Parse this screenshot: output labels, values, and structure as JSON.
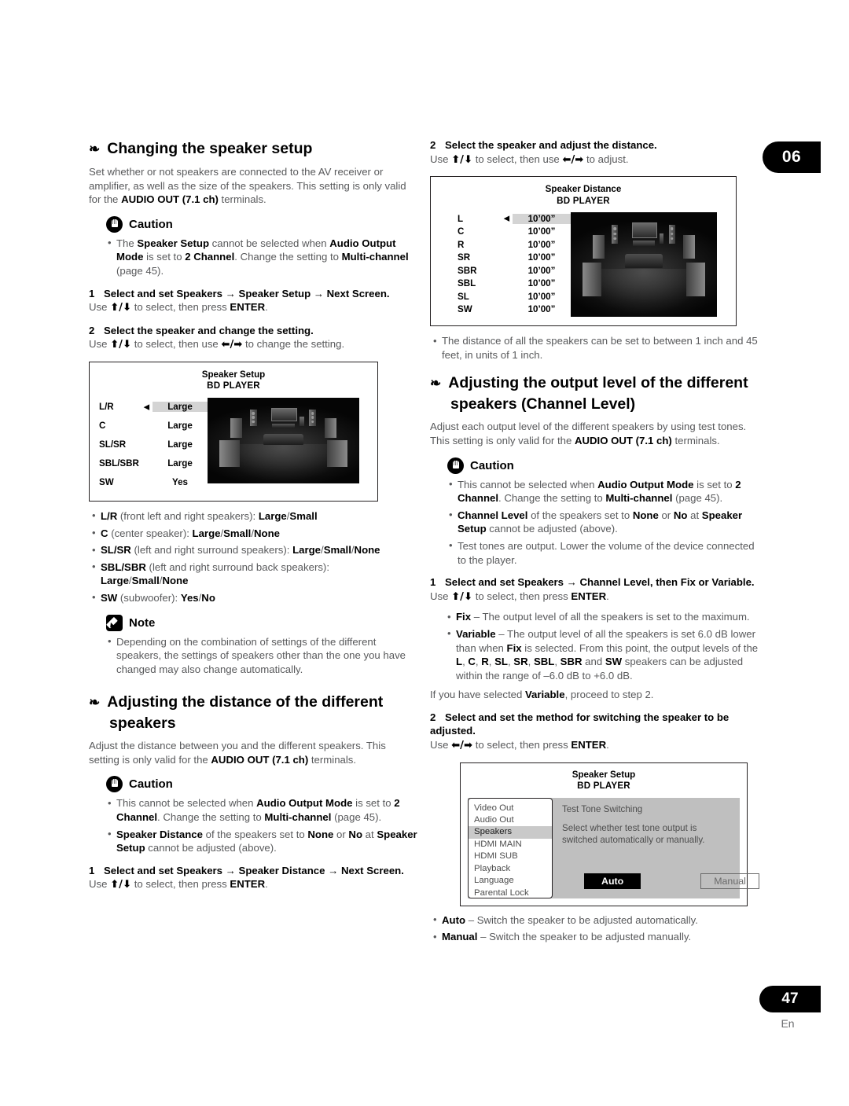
{
  "page": {
    "chapter_tab": "06",
    "page_number": "47",
    "language_mark": "En"
  },
  "left_column": {
    "section1": {
      "heading": "Changing the speaker setup",
      "intro_html": "Set whether or not speakers are connected to the AV receiver or amplifier, as well as the size of the speakers. This setting is only valid for the <b>AUDIO OUT (7.1 ch)</b> terminals.",
      "caution_label": "Caution",
      "caution_bullets_html": [
        "The <b>Speaker Setup</b> cannot be selected when <b>Audio Output Mode</b> is set to <b>2 Channel</b>. Change the setting to <b>Multi-channel</b> (page 45)."
      ],
      "step1_num": "1",
      "step1_text": "Select and set Speakers → Speaker Setup → Next Screen.",
      "step1_sub_html": "Use <b class=\"arrow-glyph\">⬆/⬇</b> to select, then press <b>ENTER</b>.",
      "step2_num": "2",
      "step2_text": "Select the speaker and change the setting.",
      "step2_sub_html": "Use <b class=\"arrow-glyph\">⬆/⬇</b> to select, then use <b class=\"arrow-glyph\">⬅/➡</b> to change the setting.",
      "screenshot": {
        "title": "Speaker Setup",
        "subtitle": "BD PLAYER",
        "rows": [
          {
            "label": "L/R",
            "value": "Large",
            "selected": true
          },
          {
            "label": "C",
            "value": "Large",
            "selected": false
          },
          {
            "label": "SL/SR",
            "value": "Large",
            "selected": false
          },
          {
            "label": "SBL/SBR",
            "value": "Large",
            "selected": false
          },
          {
            "label": "SW",
            "value": "Yes",
            "selected": false
          }
        ]
      },
      "option_bullets_html": [
        "<b>L/R</b> (front left and right speakers): <b>Large</b>/<b>Small</b>",
        "<b>C</b> (center speaker): <b>Large</b>/<b>Small</b>/<b>None</b>",
        "<b>SL/SR</b> (left and right surround speakers): <b>Large</b>/<b>Small</b>/<b>None</b>",
        "<b>SBL/SBR</b> (left and right surround back speakers): <b>Large</b>/<b>Small</b>/<b>None</b>",
        "<b>SW</b> (subwoofer): <b>Yes</b>/<b>No</b>"
      ],
      "note_label": "Note",
      "note_bullets_html": [
        "Depending on the combination of settings of the different speakers, the settings of speakers other than the one you have changed may also change automatically."
      ]
    },
    "section2": {
      "heading": "Adjusting the distance of the different speakers",
      "intro_html": "Adjust the distance between you and the different speakers. This setting is only valid for the <b>AUDIO OUT (7.1 ch)</b> terminals.",
      "caution_label": "Caution",
      "caution_bullets_html": [
        "This cannot be selected when <b>Audio Output Mode</b> is set to <b>2 Channel</b>. Change the setting to <b>Multi-channel</b> (page 45).",
        "<b>Speaker Distance</b> of the speakers set to <b>None</b> or <b>No</b> at <b>Speaker Setup</b> cannot be adjusted (above)."
      ],
      "step1_num": "1",
      "step1_text": "Select and set Speakers → Speaker Distance → Next Screen.",
      "step1_sub_html": "Use <b class=\"arrow-glyph\">⬆/⬇</b> to select, then press <b>ENTER</b>."
    }
  },
  "right_column": {
    "distance_step2": {
      "num": "2",
      "text": "Select the speaker and adjust the distance.",
      "sub_html": "Use <b class=\"arrow-glyph\">⬆/⬇</b> to select, then use <b class=\"arrow-glyph\">⬅/➡</b> to adjust.",
      "screenshot": {
        "title": "Speaker Distance",
        "subtitle": "BD PLAYER",
        "rows": [
          {
            "label": "L",
            "value": "10’00”",
            "selected": true
          },
          {
            "label": "C",
            "value": "10’00”",
            "selected": false
          },
          {
            "label": "R",
            "value": "10’00”",
            "selected": false
          },
          {
            "label": "SR",
            "value": "10’00”",
            "selected": false
          },
          {
            "label": "SBR",
            "value": "10’00”",
            "selected": false
          },
          {
            "label": "SBL",
            "value": "10’00”",
            "selected": false
          },
          {
            "label": "SL",
            "value": "10’00”",
            "selected": false
          },
          {
            "label": "SW",
            "value": "10’00”",
            "selected": false
          }
        ]
      },
      "after_bullets_html": [
        "The distance of all the speakers can be set to between 1 inch and 45 feet, in units of 1 inch."
      ]
    },
    "section3": {
      "heading": "Adjusting the output level of the different speakers (Channel Level)",
      "intro_html": "Adjust each output level of the different speakers by using test tones. This setting is only valid for the <b>AUDIO OUT (7.1 ch)</b> terminals.",
      "caution_label": "Caution",
      "caution_bullets_html": [
        "This cannot be selected when <b>Audio Output Mode</b> is set to <b>2 Channel</b>. Change the setting to <b>Multi-channel</b> (page 45).",
        "<b>Channel Level</b> of the speakers set to <b>None</b> or <b>No</b> at <b>Speaker Setup</b> cannot be adjusted (above).",
        "Test tones are output. Lower the volume of the device connected to the player."
      ],
      "step1_num": "1",
      "step1_text": "Select and set Speakers → Channel Level, then Fix or Variable.",
      "step1_sub_html": "Use <b class=\"arrow-glyph\">⬆/⬇</b> to select, then press <b>ENTER</b>.",
      "step1_bullets_html": [
        "<b>Fix</b> – The output level of all the speakers is set to the maximum.",
        "<b>Variable</b> – The output level of all the speakers is set 6.0 dB lower than when <b>Fix</b> is selected. From this point, the output levels of the <b>L</b>, <b>C</b>, <b>R</b>, <b>SL</b>, <b>SR</b>, <b>SBL</b>, <b>SBR</b> and <b>SW</b> speakers can be adjusted within the range of –6.0 dB to +6.0 dB."
      ],
      "step1_after_html": "If you have selected <b>Variable</b>, proceed to step 2.",
      "step2_num": "2",
      "step2_text": "Select and set the method for switching the speaker to be adjusted.",
      "step2_sub_html": "Use <b class=\"arrow-glyph\">⬅/➡</b> to select, then press <b>ENTER</b>.",
      "menu_screenshot": {
        "title": "Speaker Setup",
        "subtitle": "BD PLAYER",
        "menu_items": [
          {
            "label": "Video Out",
            "active": false
          },
          {
            "label": "Audio Out",
            "active": false
          },
          {
            "label": "Speakers",
            "active": true
          },
          {
            "label": "HDMI MAIN",
            "active": false
          },
          {
            "label": "HDMI SUB",
            "active": false
          },
          {
            "label": "Playback",
            "active": false
          },
          {
            "label": "Language",
            "active": false
          },
          {
            "label": "Parental Lock",
            "active": false
          }
        ],
        "detail_title": "Test Tone Switching",
        "detail_desc": "Select whether test tone output is switched automatically or manually.",
        "button_auto": "Auto",
        "button_manual": "Manual"
      },
      "final_bullets_html": [
        "<b>Auto</b> – Switch the speaker to be adjusted automatically.",
        "<b>Manual</b> – Switch the speaker to be adjusted manually."
      ]
    }
  }
}
